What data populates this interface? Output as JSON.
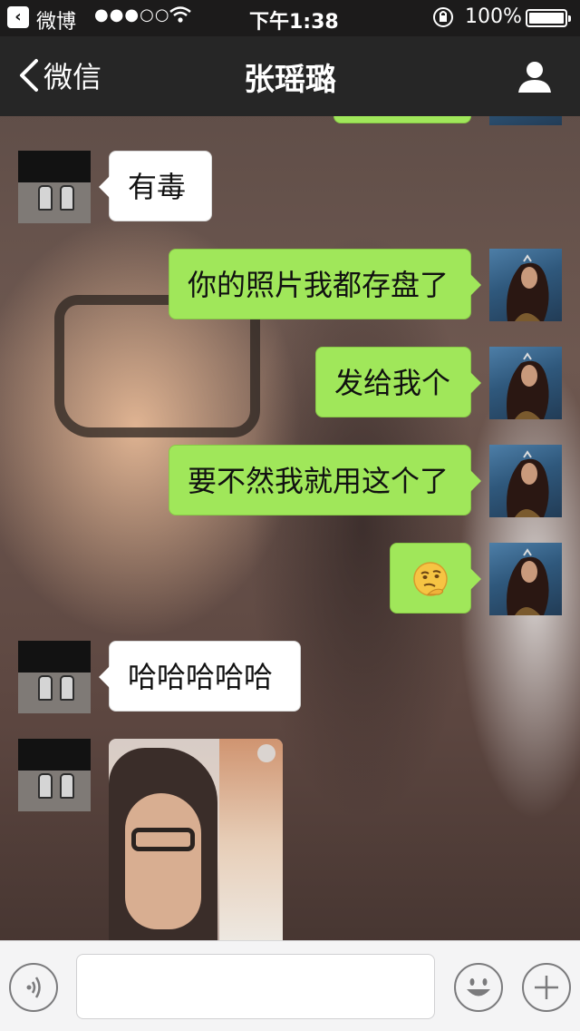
{
  "status_bar": {
    "back_app": "微博",
    "signal": "●●●○○",
    "time": "下午1:38",
    "battery": "100%"
  },
  "nav": {
    "back_label": "微信",
    "title": "张瑶璐"
  },
  "messages": [
    {
      "from": "friend",
      "text": "有毒"
    },
    {
      "from": "self",
      "text": "你的照片我都存盘了"
    },
    {
      "from": "self",
      "text": "发给我个"
    },
    {
      "from": "self",
      "text": "要不然我就用这个了"
    },
    {
      "from": "self",
      "kind": "emoji",
      "icon": "thinking-emoji"
    },
    {
      "from": "friend",
      "text": "哈哈哈哈哈"
    },
    {
      "from": "friend",
      "kind": "photo"
    }
  ],
  "input": {
    "placeholder": ""
  },
  "colors": {
    "outgoing_bubble": "#a0e75a",
    "incoming_bubble": "#ffffff",
    "nav_background": "#262626"
  }
}
